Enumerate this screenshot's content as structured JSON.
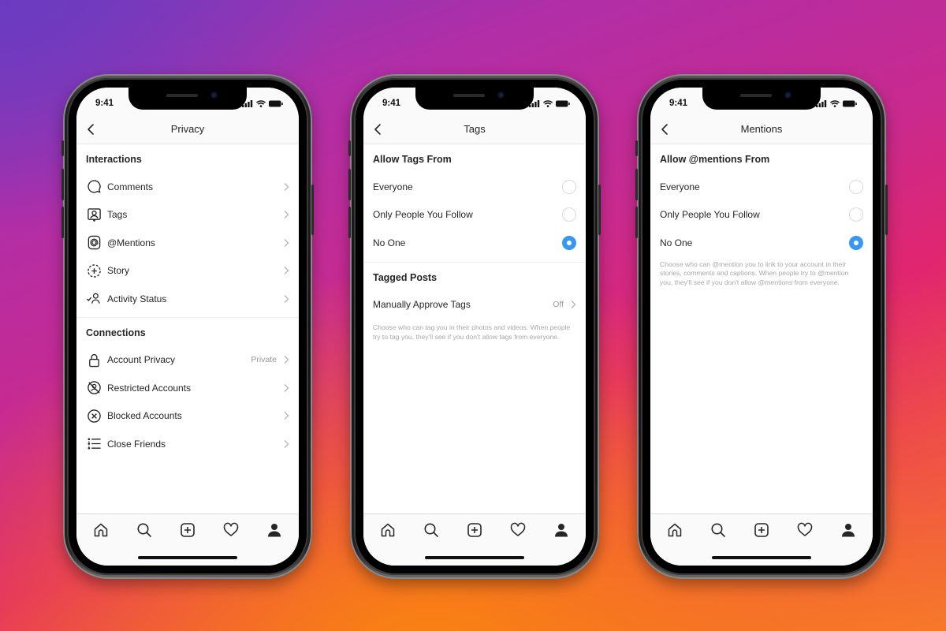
{
  "status_bar": {
    "time": "9:41"
  },
  "accent_color": "#3897f0",
  "phones": [
    {
      "title": "Privacy",
      "sections": [
        {
          "title": "Interactions",
          "items": [
            {
              "label": "Comments",
              "icon": "comment-bubble-icon",
              "value": ""
            },
            {
              "label": "Tags",
              "icon": "tag-person-icon",
              "value": ""
            },
            {
              "label": "@Mentions",
              "icon": "at-sign-icon",
              "value": ""
            },
            {
              "label": "Story",
              "icon": "story-add-icon",
              "value": ""
            },
            {
              "label": "Activity Status",
              "icon": "activity-status-icon",
              "value": ""
            }
          ]
        },
        {
          "title": "Connections",
          "items": [
            {
              "label": "Account Privacy",
              "icon": "lock-icon",
              "value": "Private"
            },
            {
              "label": "Restricted Accounts",
              "icon": "restricted-icon",
              "value": ""
            },
            {
              "label": "Blocked Accounts",
              "icon": "blocked-x-icon",
              "value": ""
            },
            {
              "label": "Close Friends",
              "icon": "list-icon",
              "value": ""
            }
          ]
        }
      ]
    },
    {
      "title": "Tags",
      "radio_section": {
        "title": "Allow Tags From",
        "options": [
          {
            "label": "Everyone",
            "selected": false
          },
          {
            "label": "Only People You Follow",
            "selected": false
          },
          {
            "label": "No One",
            "selected": true
          }
        ]
      },
      "tagged_posts": {
        "title": "Tagged Posts",
        "row_label": "Manually Approve Tags",
        "row_value": "Off"
      },
      "helper_text": "Choose who can tag you in their photos and videos. When people try to tag you, they'll see if you don't allow tags from everyone."
    },
    {
      "title": "Mentions",
      "radio_section": {
        "title": "Allow @mentions From",
        "options": [
          {
            "label": "Everyone",
            "selected": false
          },
          {
            "label": "Only People You Follow",
            "selected": false
          },
          {
            "label": "No One",
            "selected": true
          }
        ]
      },
      "helper_text": "Choose who can @mention you to link to your account in their stories, comments and captions. When people try to @mention you, they'll see if you don't allow @mentions from everyone."
    }
  ],
  "tab_bar": [
    {
      "name": "home",
      "icon": "home-icon"
    },
    {
      "name": "search",
      "icon": "search-icon"
    },
    {
      "name": "new-post",
      "icon": "plus-square-icon"
    },
    {
      "name": "activity",
      "icon": "heart-icon"
    },
    {
      "name": "profile",
      "icon": "profile-icon"
    }
  ]
}
